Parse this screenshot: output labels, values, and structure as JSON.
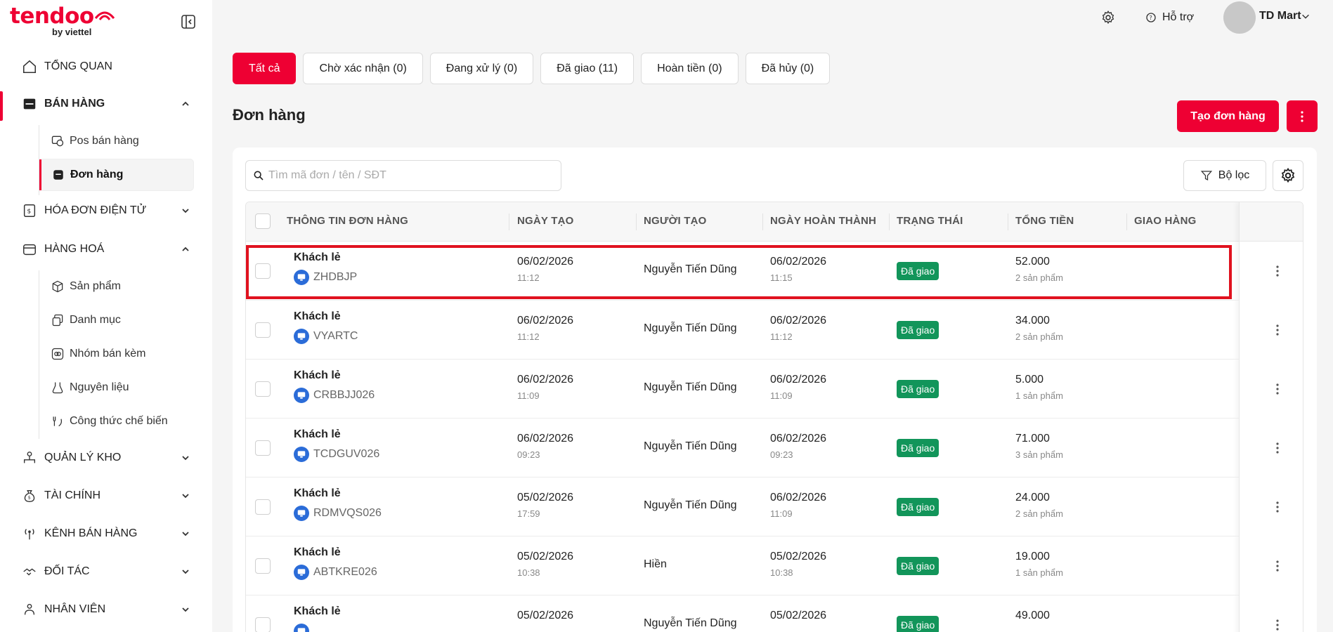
{
  "sidebar": {
    "logo_text": "tendoo",
    "logo_sub": "by viettel",
    "items": [
      {
        "label": "TỔNG QUAN",
        "icon": "home-icon"
      },
      {
        "label": "BÁN HÀNG",
        "icon": "store-icon"
      },
      {
        "label": "HÓA ĐƠN ĐIỆN TỬ",
        "icon": "invoice-icon"
      },
      {
        "label": "HÀNG HOÁ",
        "icon": "goods-icon"
      },
      {
        "label": "QUẢN LÝ KHO",
        "icon": "warehouse-icon"
      },
      {
        "label": "TÀI CHÍNH",
        "icon": "finance-icon"
      },
      {
        "label": "KÊNH BÁN HÀNG",
        "icon": "channel-icon"
      },
      {
        "label": "ĐỐI TÁC",
        "icon": "partner-icon"
      },
      {
        "label": "NHÂN VIÊN",
        "icon": "staff-icon"
      }
    ],
    "sales_sub": [
      {
        "label": "Pos bán hàng",
        "icon": "pos-icon"
      },
      {
        "label": "Đơn hàng",
        "icon": "order-icon"
      }
    ],
    "goods_sub": [
      {
        "label": "Sản phẩm",
        "icon": "box-icon"
      },
      {
        "label": "Danh mục",
        "icon": "category-icon"
      },
      {
        "label": "Nhóm bán kèm",
        "icon": "bundle-icon"
      },
      {
        "label": "Nguyên liệu",
        "icon": "ingredient-icon"
      },
      {
        "label": "Công thức chế biến",
        "icon": "recipe-icon"
      }
    ]
  },
  "header": {
    "help_label": "Hỗ trợ",
    "shop_name": "TD Mart"
  },
  "tabs": [
    {
      "label": "Tất cả",
      "active": true
    },
    {
      "label": "Chờ xác nhận (0)"
    },
    {
      "label": "Đang xử lý (0)"
    },
    {
      "label": "Đã giao (11)"
    },
    {
      "label": "Hoàn tiền (0)"
    },
    {
      "label": "Đã hủy (0)"
    }
  ],
  "page": {
    "title": "Đơn hàng",
    "create_label": "Tạo đơn hàng",
    "search_placeholder": "Tìm mã đơn / tên / SĐT",
    "filter_label": "Bộ lọc"
  },
  "table": {
    "columns": [
      "THÔNG TIN ĐƠN HÀNG",
      "NGÀY TẠO",
      "NGƯỜI TẠO",
      "NGÀY HOÀN THÀNH",
      "TRẠNG THÁI",
      "TỔNG TIỀN",
      "GIAO HÀNG"
    ],
    "rows": [
      {
        "customer": "Khách lẻ",
        "code": "ZHDBJP",
        "created_date": "06/02/2026",
        "created_time": "11:12",
        "creator": "Nguyễn Tiến Dũng",
        "done_date": "06/02/2026",
        "done_time": "11:15",
        "status": "Đã giao",
        "total": "52.000",
        "qty": "2 sản phẩm"
      },
      {
        "customer": "Khách lẻ",
        "code": "VYARTC",
        "created_date": "06/02/2026",
        "created_time": "11:12",
        "creator": "Nguyễn Tiến Dũng",
        "done_date": "06/02/2026",
        "done_time": "11:12",
        "status": "Đã giao",
        "total": "34.000",
        "qty": "2 sản phẩm"
      },
      {
        "customer": "Khách lẻ",
        "code": "CRBBJJ026",
        "created_date": "06/02/2026",
        "created_time": "11:09",
        "creator": "Nguyễn Tiến Dũng",
        "done_date": "06/02/2026",
        "done_time": "11:09",
        "status": "Đã giao",
        "total": "5.000",
        "qty": "1 sản phẩm"
      },
      {
        "customer": "Khách lẻ",
        "code": "TCDGUV026",
        "created_date": "06/02/2026",
        "created_time": "09:23",
        "creator": "Nguyễn Tiến Dũng",
        "done_date": "06/02/2026",
        "done_time": "09:23",
        "status": "Đã giao",
        "total": "71.000",
        "qty": "3 sản phẩm"
      },
      {
        "customer": "Khách lẻ",
        "code": "RDMVQS026",
        "created_date": "05/02/2026",
        "created_time": "17:59",
        "creator": "Nguyễn Tiến Dũng",
        "done_date": "06/02/2026",
        "done_time": "11:09",
        "status": "Đã giao",
        "total": "24.000",
        "qty": "2 sản phẩm"
      },
      {
        "customer": "Khách lẻ",
        "code": "ABTKRE026",
        "created_date": "05/02/2026",
        "created_time": "10:38",
        "creator": "Hiền",
        "done_date": "05/02/2026",
        "done_time": "10:38",
        "status": "Đã giao",
        "total": "19.000",
        "qty": "1 sản phẩm"
      },
      {
        "customer": "Khách lẻ",
        "code": "",
        "created_date": "05/02/2026",
        "created_time": "",
        "creator": "Nguyễn Tiến Dũng",
        "done_date": "05/02/2026",
        "done_time": "",
        "status": "Đã giao",
        "total": "49.000",
        "qty": ""
      }
    ]
  },
  "colors": {
    "brand": "#ee0033",
    "status_delivered": "#12955a",
    "pos_icon": "#2b6cd8"
  }
}
